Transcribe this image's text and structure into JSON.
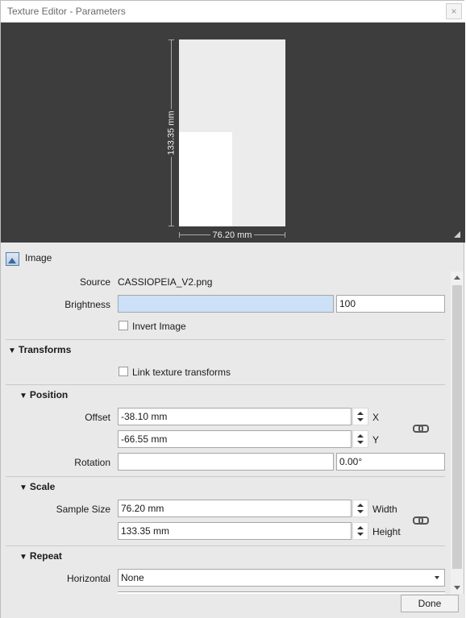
{
  "window": {
    "title": "Texture Editor - Parameters",
    "close_glyph": "×"
  },
  "preview": {
    "height_label": "133.35 mm",
    "width_label": "76.20 mm"
  },
  "image_section": {
    "label": "Image",
    "icon": "image-icon"
  },
  "source": {
    "label": "Source",
    "value": "CASSIOPEIA_V2.png"
  },
  "brightness": {
    "label": "Brightness",
    "value": "100",
    "fill_color": "#cce0f8"
  },
  "invert": {
    "label": "Invert Image",
    "checked": false
  },
  "transforms": {
    "title": "Transforms",
    "link_label": "Link texture transforms",
    "linked": false
  },
  "position": {
    "title": "Position",
    "offset_label": "Offset",
    "x_value": "-38.10 mm",
    "x_axis": "X",
    "y_value": "-66.55 mm",
    "y_axis": "Y",
    "rotation_label": "Rotation",
    "rotation_value": "0.00°"
  },
  "scale": {
    "title": "Scale",
    "sample_size_label": "Sample Size",
    "width_value": "76.20 mm",
    "width_label": "Width",
    "height_value": "133.35 mm",
    "height_label": "Height"
  },
  "repeat": {
    "title": "Repeat",
    "horizontal_label": "Horizontal",
    "horizontal_value": "None"
  },
  "footer": {
    "done_label": "Done"
  }
}
